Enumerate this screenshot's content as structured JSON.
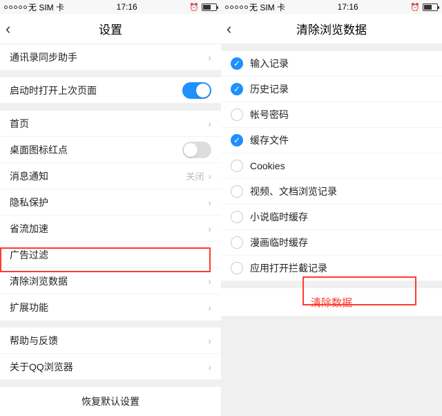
{
  "status": {
    "carrier": "无 SIM 卡",
    "time": "17:16"
  },
  "left": {
    "title": "设置",
    "rows1": [
      {
        "label": "通讯录同步助手"
      }
    ],
    "rows2": {
      "label": "启动时打开上次页面",
      "on": true
    },
    "rows3": [
      {
        "label": "首页",
        "type": "chev"
      },
      {
        "label": "桌面图标红点",
        "type": "toggle",
        "on": false
      },
      {
        "label": "消息通知",
        "type": "detail",
        "detail": "关闭"
      },
      {
        "label": "隐私保护",
        "type": "chev"
      },
      {
        "label": "省流加速",
        "type": "chev"
      },
      {
        "label": "广告过滤",
        "type": "chev"
      },
      {
        "label": "清除浏览数据",
        "type": "chev"
      },
      {
        "label": "扩展功能",
        "type": "chev"
      }
    ],
    "rows4": [
      {
        "label": "帮助与反馈"
      },
      {
        "label": "关于QQ浏览器"
      }
    ],
    "reset": "恢复默认设置"
  },
  "right": {
    "title": "清除浏览数据",
    "items": [
      {
        "label": "输入记录",
        "checked": true
      },
      {
        "label": "历史记录",
        "checked": true
      },
      {
        "label": "帐号密码",
        "checked": false
      },
      {
        "label": "缓存文件",
        "checked": true
      },
      {
        "label": "Cookies",
        "checked": false
      },
      {
        "label": "视频、文档浏览记录",
        "checked": false
      },
      {
        "label": "小说临时缓存",
        "checked": false
      },
      {
        "label": "漫画临时缓存",
        "checked": false
      },
      {
        "label": "应用打开拦截记录",
        "checked": false
      }
    ],
    "clear": "清除数据"
  }
}
